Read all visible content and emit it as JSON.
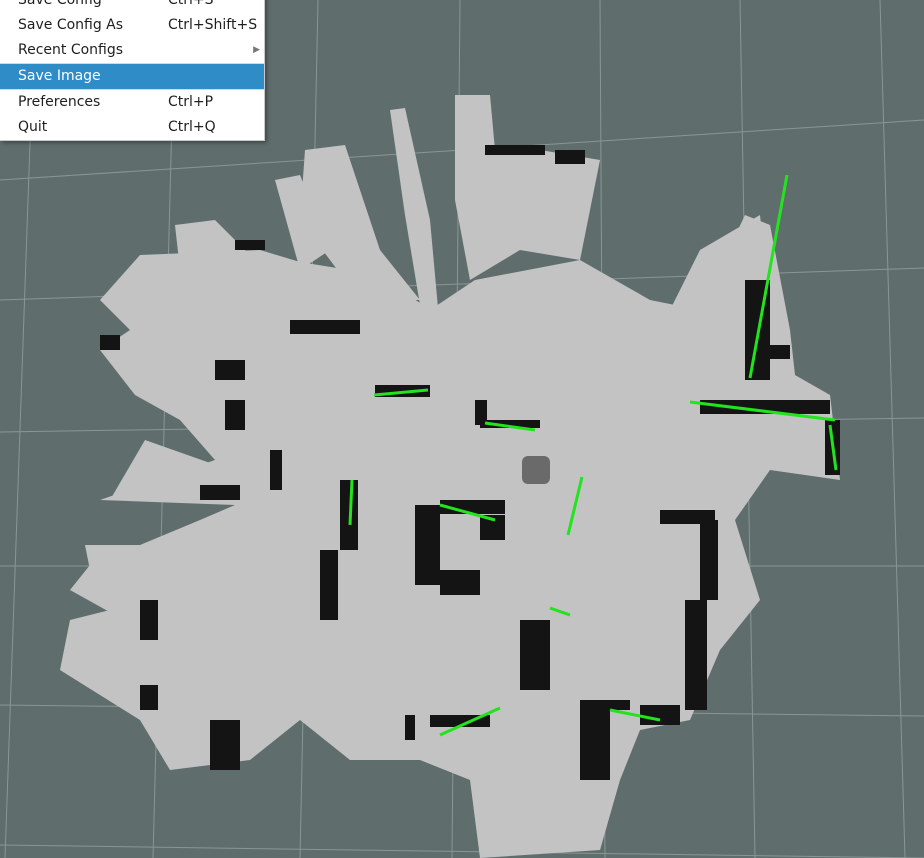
{
  "menu": {
    "items": [
      {
        "label": "Save Config",
        "shortcut": "Ctrl+S"
      },
      {
        "label": "Save Config As",
        "shortcut": "Ctrl+Shift+S"
      },
      {
        "label": "Recent Configs",
        "shortcut": ""
      },
      {
        "label": "Save Image",
        "shortcut": ""
      },
      {
        "label": "Preferences",
        "shortcut": "Ctrl+P"
      },
      {
        "label": "Quit",
        "shortcut": "Ctrl+Q"
      }
    ],
    "selected_index": 3
  },
  "colors": {
    "background": "#5f6e6d",
    "grid": "#8a9696",
    "free": "#c3c3c3",
    "occupied": "#141414",
    "laser": "#23e31f",
    "robot": "#6a6a6a",
    "menu_highlight": "#308cc6"
  },
  "icons": [
    "submenu-arrow-icon"
  ]
}
